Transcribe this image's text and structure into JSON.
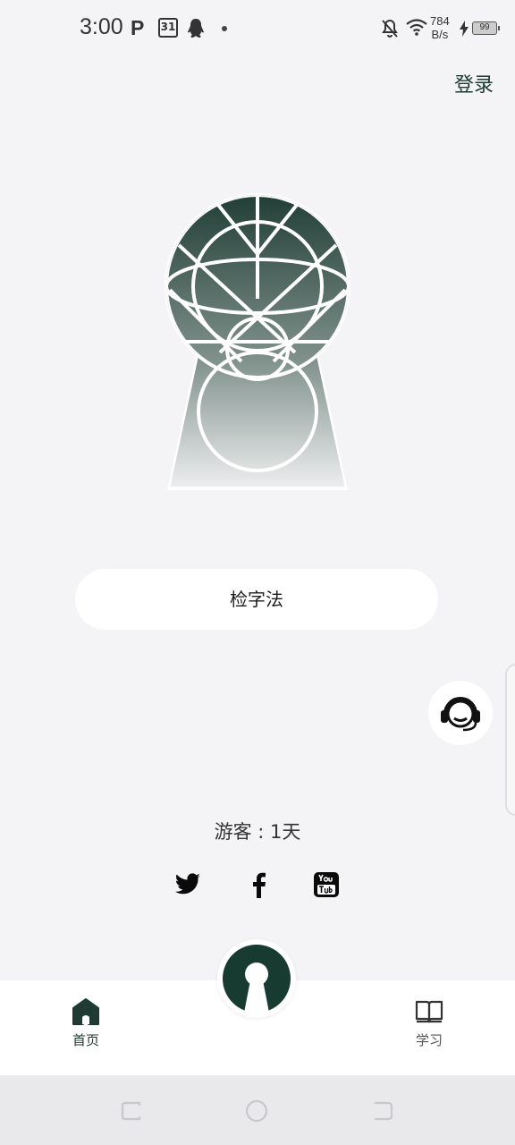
{
  "status_bar": {
    "time": "3:00",
    "p_icon": "P",
    "calendar_day": "31",
    "net_speed_value": "784",
    "net_speed_unit": "B/s",
    "battery_level": "99"
  },
  "header": {
    "login_label": "登录"
  },
  "main": {
    "button_label": "检字法"
  },
  "guest": {
    "text": "游客 : 1天"
  },
  "social": [
    "twitter-icon",
    "facebook-icon",
    "youtube-icon"
  ],
  "bottom_nav": {
    "home_label": "首页",
    "study_label": "学习"
  },
  "colors": {
    "brand": "#1f3a33",
    "background": "#f4f3f5",
    "card": "#ffffff"
  }
}
